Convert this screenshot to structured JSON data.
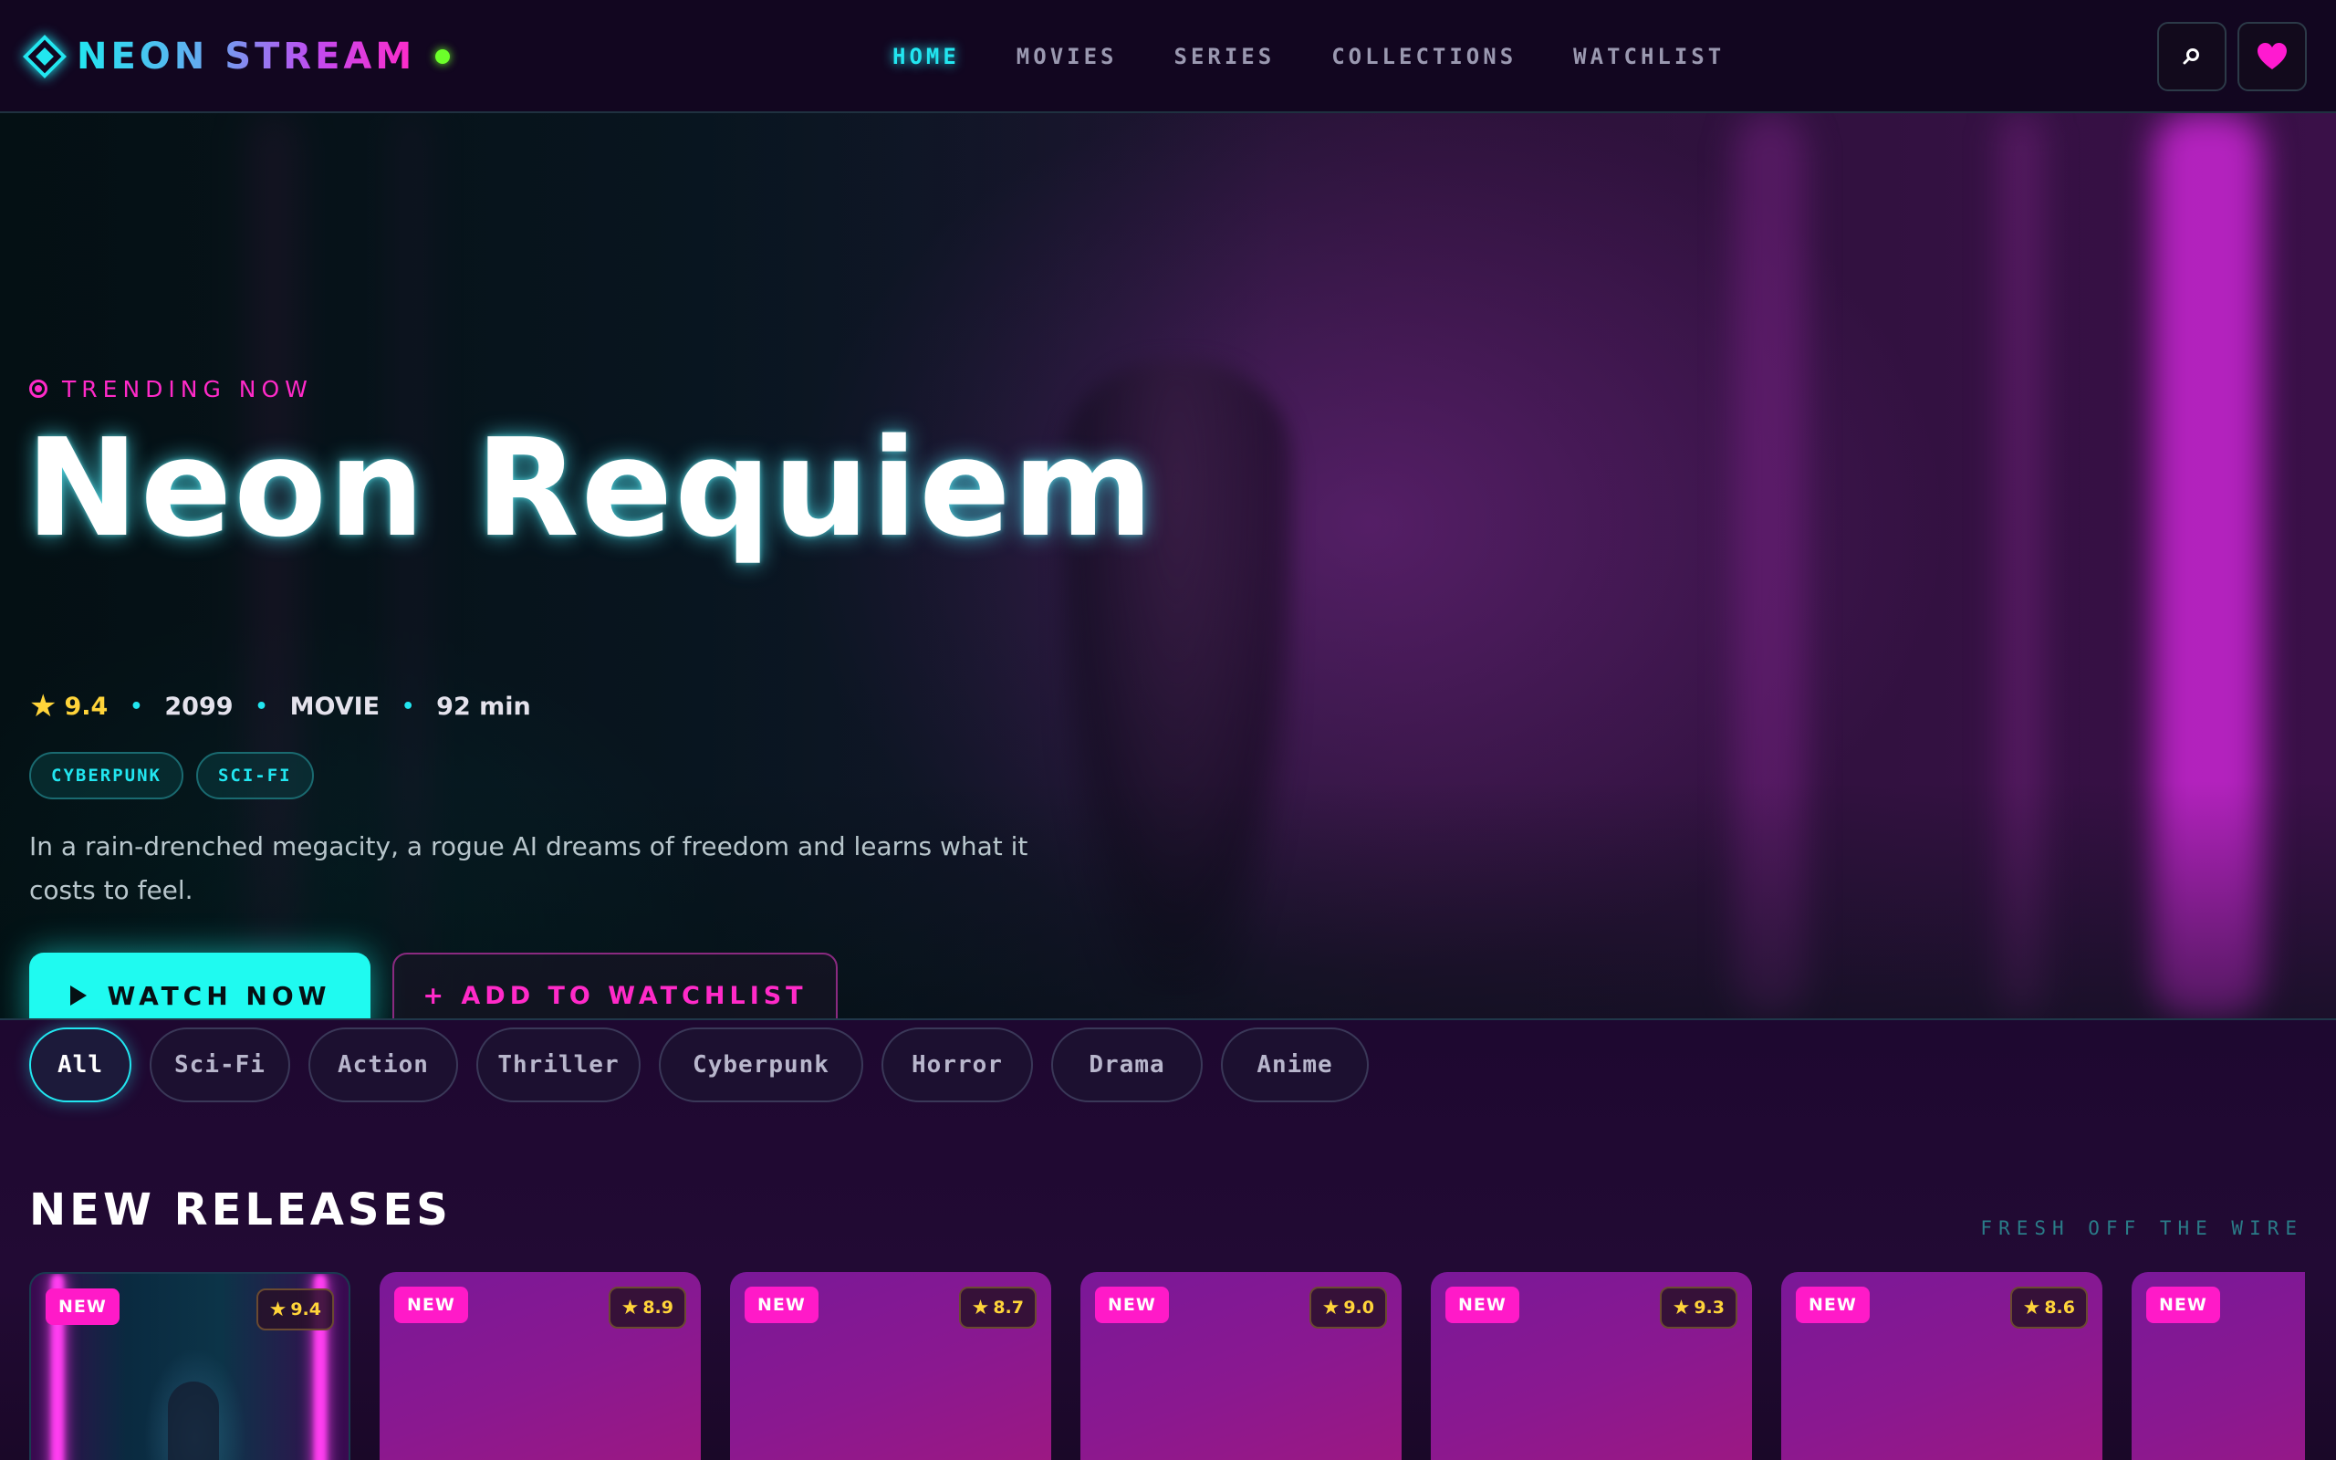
{
  "nav": {
    "logo": "NEON STREAM",
    "links": [
      {
        "label": "HOME",
        "active": true
      },
      {
        "label": "MOVIES",
        "active": false
      },
      {
        "label": "SERIES",
        "active": false
      },
      {
        "label": "COLLECTIONS",
        "active": false
      },
      {
        "label": "WATCHLIST",
        "active": false
      }
    ],
    "search_icon": "search-icon",
    "favorites_icon": "heart-icon"
  },
  "hero": {
    "eyebrow": "TRENDING NOW",
    "title": "Neon Requiem",
    "rating": "9.4",
    "year": "2099",
    "type": "MOVIE",
    "duration": "92 min",
    "tags": [
      "CYBERPUNK",
      "SCI-FI"
    ],
    "description": "In a rain-drenched megacity, a rogue AI dreams of freedom and learns what it costs to feel.",
    "watch_label": "WATCH NOW",
    "watchlist_label": "+ ADD TO WATCHLIST",
    "carousel": {
      "count": 5,
      "active_index": 0
    }
  },
  "filters": [
    {
      "label": "All",
      "active": true
    },
    {
      "label": "Sci-Fi",
      "active": false
    },
    {
      "label": "Action",
      "active": false
    },
    {
      "label": "Thriller",
      "active": false
    },
    {
      "label": "Cyberpunk",
      "active": false
    },
    {
      "label": "Horror",
      "active": false
    },
    {
      "label": "Drama",
      "active": false
    },
    {
      "label": "Anime",
      "active": false
    }
  ],
  "releases": {
    "title": "NEW RELEASES",
    "subtitle": "FRESH OFF THE WIRE",
    "cards": [
      {
        "badge": "NEW",
        "rating": "9.4"
      },
      {
        "badge": "NEW",
        "rating": "8.9"
      },
      {
        "badge": "NEW",
        "rating": "8.7"
      },
      {
        "badge": "NEW",
        "rating": "9.0"
      },
      {
        "badge": "NEW",
        "rating": "9.3"
      },
      {
        "badge": "NEW",
        "rating": "8.6"
      },
      {
        "badge": "NEW",
        "rating": ""
      }
    ]
  },
  "colors": {
    "accent_cyan": "#22e6f0",
    "accent_magenta": "#ff2ac8",
    "rating_gold": "#ffd43a",
    "status_green": "#6cff2a"
  }
}
